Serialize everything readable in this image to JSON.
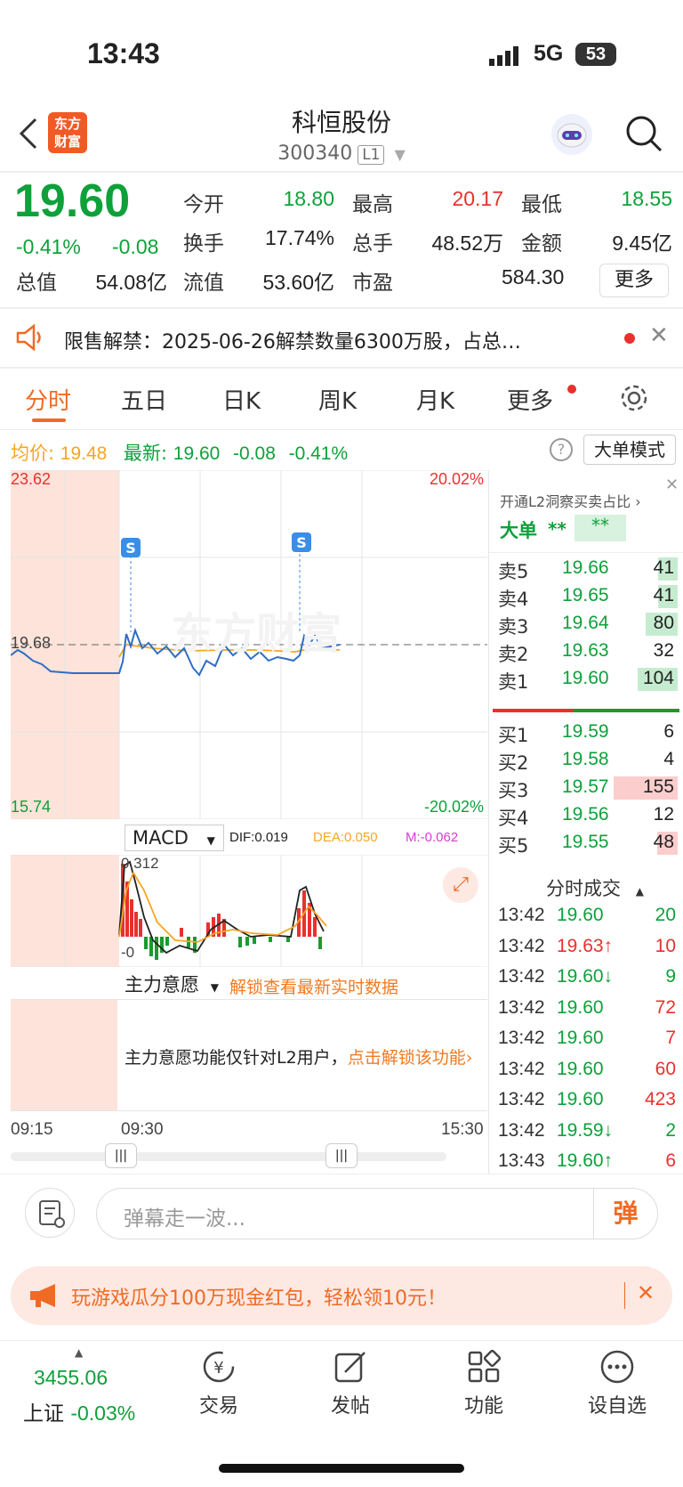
{
  "status_bar": {
    "time": "13:43",
    "network": "5G",
    "battery": "53"
  },
  "header": {
    "back_icon": "chevron-left-icon",
    "logo_text": "东方\n财富",
    "title": "科恒股份",
    "code": "300340",
    "level": "L1",
    "search_icon": "search-icon"
  },
  "quote": {
    "price": "19.60",
    "change_pct": "-0.41%",
    "change": "-0.08",
    "fields": [
      {
        "label": "今开",
        "value": "18.80",
        "color": "green"
      },
      {
        "label": "最高",
        "value": "20.17",
        "color": "red"
      },
      {
        "label": "最低",
        "value": "18.55",
        "color": "green"
      },
      {
        "label": "换手",
        "value": "17.74%",
        "color": "black"
      },
      {
        "label": "总手",
        "value": "48.52万",
        "color": "black"
      },
      {
        "label": "金额",
        "value": "9.45亿",
        "color": "black"
      },
      {
        "label": "总值",
        "value": "54.08亿",
        "color": "black"
      },
      {
        "label": "流值",
        "value": "53.60亿",
        "color": "black"
      },
      {
        "label": "市盈",
        "value": "584.30",
        "color": "black"
      }
    ],
    "more_button": "更多"
  },
  "notice": {
    "text": "限售解禁：2025-06-26解禁数量6300万股，占总…"
  },
  "tabs": [
    "分时",
    "五日",
    "日K",
    "周K",
    "月K",
    "更多"
  ],
  "summary": {
    "avg_label": "均价:",
    "avg_value": "19.48",
    "latest_label": "最新:",
    "latest_value": "19.60",
    "latest_change": "-0.08",
    "latest_pct": "-0.41%",
    "big_order_mode": "大单模式"
  },
  "chart_data": {
    "type": "line",
    "price_axis": {
      "top": "23.62",
      "mid": "19.68",
      "bottom": "15.74",
      "top_pct": "20.02%",
      "bottom_pct": "-20.02%"
    },
    "time_labels": [
      "09:15",
      "09:30",
      "15:30"
    ],
    "macd": {
      "label": "MACD",
      "dif": "DIF:0.019",
      "dea": "DEA:0.050",
      "m": "M:-0.062",
      "top": "0.312",
      "bottom": "-0"
    }
  },
  "main_force": {
    "label": "主力意愿",
    "unlock_link": "解锁查看最新实时数据",
    "message": "主力意愿功能仅针对L2用户，",
    "message_link": "点击解锁该功能"
  },
  "order_book": {
    "l2_label": "开通L2洞察买卖占比",
    "big_label": "大单",
    "big_stars1": "**",
    "big_stars2": "**",
    "sells": [
      {
        "label": "卖5",
        "price": "19.66",
        "vol": "41",
        "bar": 0.12
      },
      {
        "label": "卖4",
        "price": "19.65",
        "vol": "41",
        "bar": 0.12
      },
      {
        "label": "卖3",
        "price": "19.64",
        "vol": "80",
        "bar": 0.2
      },
      {
        "label": "卖2",
        "price": "19.63",
        "vol": "32",
        "bar": 0.0
      },
      {
        "label": "卖1",
        "price": "19.60",
        "vol": "104",
        "bar": 0.25
      }
    ],
    "buys": [
      {
        "label": "买1",
        "price": "19.59",
        "vol": "6",
        "bar": 0.0
      },
      {
        "label": "买2",
        "price": "19.58",
        "vol": "4",
        "bar": 0.0
      },
      {
        "label": "买3",
        "price": "19.57",
        "vol": "155",
        "bar": 0.4
      },
      {
        "label": "买4",
        "price": "19.56",
        "vol": "12",
        "bar": 0.0
      },
      {
        "label": "买5",
        "price": "19.55",
        "vol": "48",
        "bar": 0.13
      }
    ]
  },
  "trades": {
    "title": "分时成交",
    "rows": [
      {
        "time": "13:42",
        "price": "19.60",
        "arrow": "",
        "vol": "20",
        "pc": "green",
        "vc": "green"
      },
      {
        "time": "13:42",
        "price": "19.63↑",
        "arrow": "",
        "vol": "10",
        "pc": "red",
        "vc": "red"
      },
      {
        "time": "13:42",
        "price": "19.60↓",
        "arrow": "",
        "vol": "9",
        "pc": "green",
        "vc": "green"
      },
      {
        "time": "13:42",
        "price": "19.60",
        "arrow": "",
        "vol": "72",
        "pc": "green",
        "vc": "red"
      },
      {
        "time": "13:42",
        "price": "19.60",
        "arrow": "",
        "vol": "7",
        "pc": "green",
        "vc": "red"
      },
      {
        "time": "13:42",
        "price": "19.60",
        "arrow": "",
        "vol": "60",
        "pc": "green",
        "vc": "red"
      },
      {
        "time": "13:42",
        "price": "19.60",
        "arrow": "",
        "vol": "423",
        "pc": "green",
        "vc": "red"
      },
      {
        "time": "13:42",
        "price": "19.59↓",
        "arrow": "",
        "vol": "2",
        "pc": "green",
        "vc": "green"
      },
      {
        "time": "13:43",
        "price": "19.60↑",
        "arrow": "",
        "vol": "6",
        "pc": "green",
        "vc": "red"
      }
    ]
  },
  "comment": {
    "placeholder": "弹幕走一波...",
    "send": "弹"
  },
  "promo": {
    "text": "玩游戏瓜分100万现金红包，轻松领10元！"
  },
  "bottom_nav": {
    "index_value": "3455.06",
    "index_label": "上证",
    "index_change": "-0.03%",
    "items": [
      "交易",
      "发帖",
      "功能",
      "设自选"
    ]
  }
}
